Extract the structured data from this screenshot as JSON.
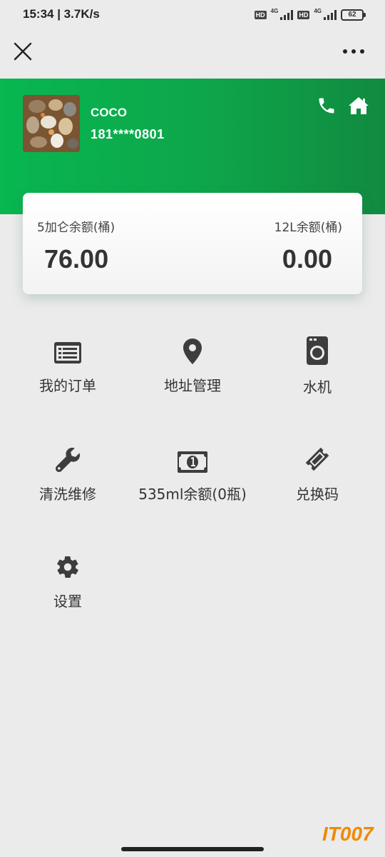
{
  "status_bar": {
    "time_speed": "15:34 | 3.7K/s",
    "hd1": "HD",
    "net1": "4G",
    "hd2": "HD",
    "net2": "4G",
    "battery": "62"
  },
  "header": {
    "user_name": "COCO",
    "user_phone": "181****0801",
    "background_colors": [
      "#08b750",
      "#118a40"
    ]
  },
  "balance": {
    "left_label": "5加仑余额(桶)",
    "left_value": "76.00",
    "right_label": "12L余额(桶)",
    "right_value": "0.00"
  },
  "menu": {
    "items": [
      {
        "label": "我的订单",
        "icon": "order-list-icon"
      },
      {
        "label": "地址管理",
        "icon": "location-pin-icon"
      },
      {
        "label": "水机",
        "icon": "water-machine-icon"
      },
      {
        "label": "清洗维修",
        "icon": "wrench-icon"
      },
      {
        "label": "535ml余额(0瓶)",
        "icon": "money-bill-icon"
      },
      {
        "label": "兑换码",
        "icon": "ticket-icon"
      },
      {
        "label": "设置",
        "icon": "gear-icon"
      }
    ]
  },
  "watermark": "IT007"
}
